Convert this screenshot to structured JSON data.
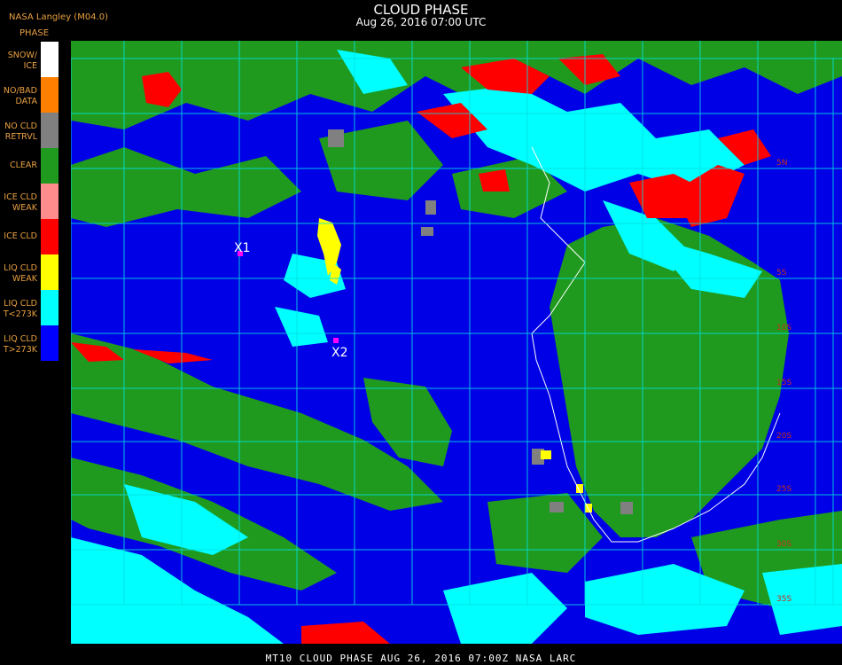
{
  "header": {
    "source": "NASA Langley (M04.0)",
    "legend_title": "PHASE",
    "title": "CLOUD PHASE",
    "subtitle": "Aug 26, 2016 07:00 UTC"
  },
  "legend": [
    {
      "label_line1": "SNOW/",
      "label_line2": "ICE",
      "color": "#ffffff"
    },
    {
      "label_line1": "NO/BAD",
      "label_line2": "DATA",
      "color": "#ff8000"
    },
    {
      "label_line1": "NO CLD",
      "label_line2": "RETRVL",
      "color": "#808080"
    },
    {
      "label_line1": "CLEAR",
      "label_line2": "",
      "color": "#1f9a1f"
    },
    {
      "label_line1": "ICE CLD",
      "label_line2": "WEAK",
      "color": "#ff8c8c"
    },
    {
      "label_line1": "ICE CLD",
      "label_line2": "",
      "color": "#ff0000"
    },
    {
      "label_line1": "LIQ CLD",
      "label_line2": "WEAK",
      "color": "#ffff00"
    },
    {
      "label_line1": "LIQ CLD",
      "label_line2": "T<273K",
      "color": "#00ffff"
    },
    {
      "label_line1": "LIQ CLD",
      "label_line2": "T>273K",
      "color": "#0000ff"
    }
  ],
  "markers": [
    {
      "label": "X1"
    },
    {
      "label": "X2"
    }
  ],
  "grid_labels": [
    "5N",
    "5S",
    "10S",
    "15S",
    "20S",
    "25S",
    "30S",
    "35S"
  ],
  "footer": "MT10  CLOUD PHASE   AUG 26, 2016 07:00Z   NASA LARC"
}
